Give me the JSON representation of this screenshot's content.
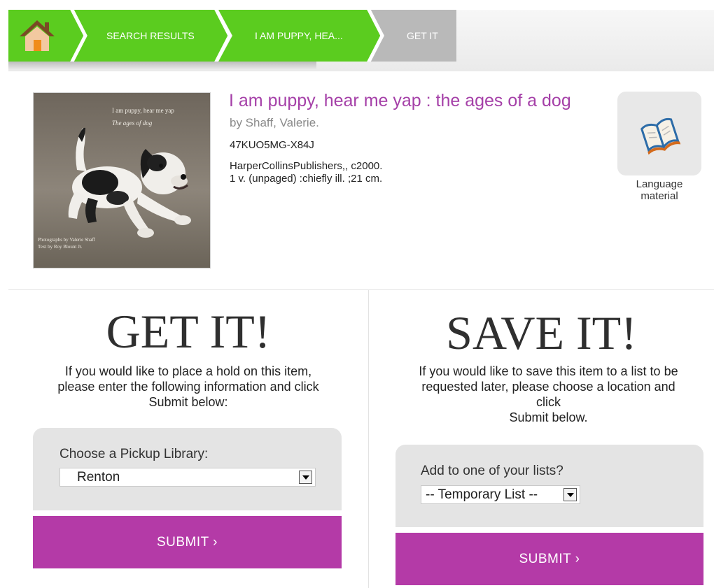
{
  "breadcrumb": {
    "home_icon": "house-icon",
    "items": [
      {
        "label": "SEARCH RESULTS"
      },
      {
        "label": "I AM PUPPY, HEA..."
      },
      {
        "label": "GET IT"
      }
    ]
  },
  "item": {
    "title": "I am puppy, hear me yap : the ages of a dog",
    "author": "by Shaff, Valerie.",
    "id": "47KUO5MG-X84J",
    "publisher": "HarperCollinsPublishers,, c2000.",
    "description": "1 v. (unpaged) :chiefly ill. ;21 cm.",
    "cover": {
      "title": "I am puppy, hear me yap",
      "subtitle": "The ages of dog",
      "credit_photo": "Photographs by Valerie Shaff",
      "credit_text": "Text by Roy Blount Jr."
    },
    "format": {
      "icon": "open-book-icon",
      "label_line1": "Language",
      "label_line2": "material"
    }
  },
  "get_it": {
    "heading": "GET IT!",
    "intro_lines": [
      "If you would like to place a hold on this item,",
      "please enter the following information and click",
      "Submit below:"
    ],
    "label": "Choose a Pickup Library:",
    "selected": "Renton",
    "submit": "SUBMIT  ›"
  },
  "save_it": {
    "heading": "SAVE IT!",
    "intro_lines": [
      "If you would like to save this item to a list to be",
      "requested later, please choose a location and",
      "click",
      "Submit below."
    ],
    "label": "Add to one of your lists?",
    "selected": "-- Temporary List --",
    "submit": "SUBMIT  ›"
  },
  "colors": {
    "breadcrumb_green": "#5bcc1f",
    "breadcrumb_grey": "#b9b9b9",
    "accent_purple": "#b43aa7",
    "title_purple": "#a540a8"
  }
}
